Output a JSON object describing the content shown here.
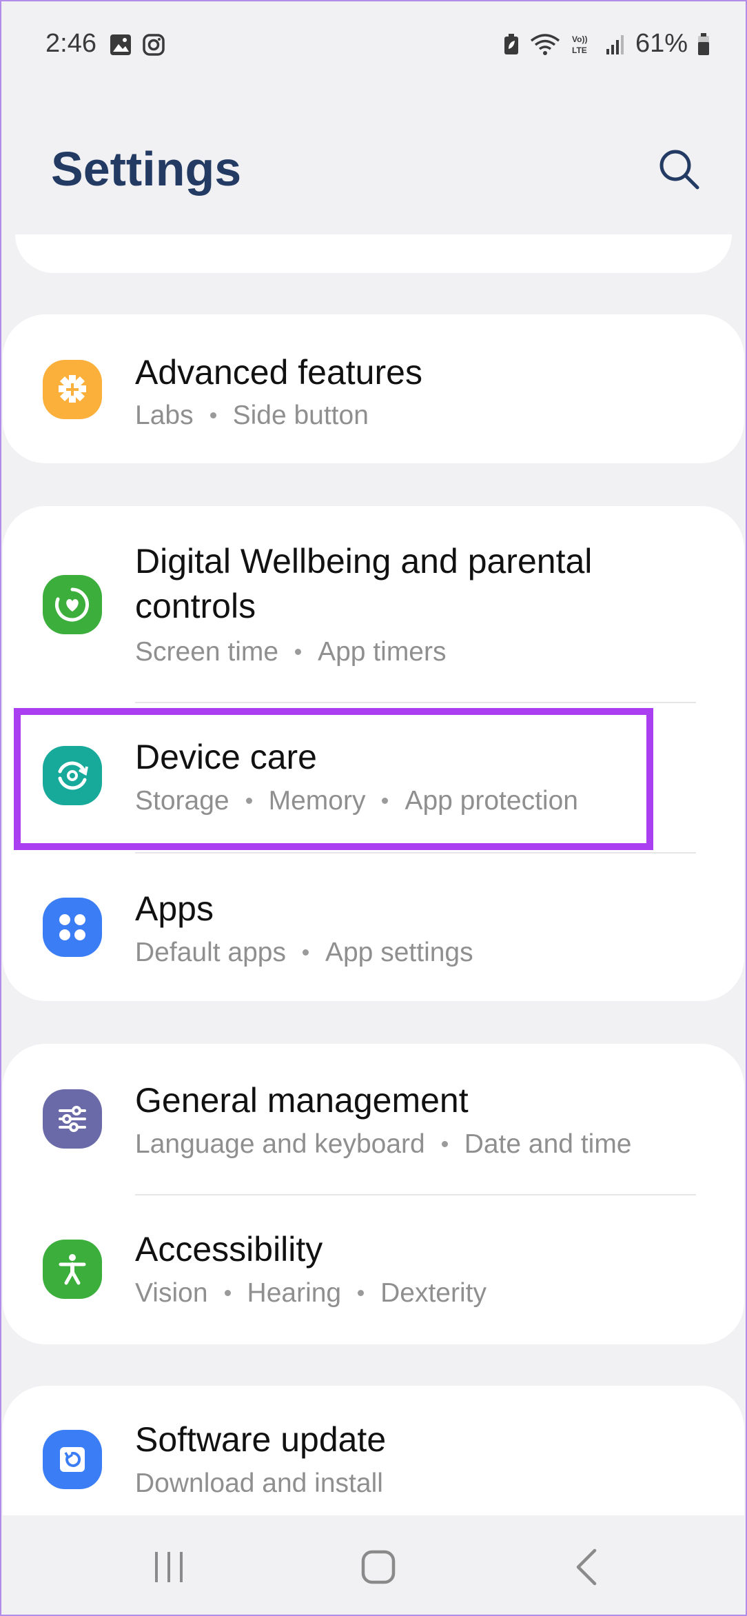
{
  "status_bar": {
    "time": "2:46",
    "battery_percent": "61%"
  },
  "header": {
    "title": "Settings"
  },
  "sections": [
    {
      "items": [
        {
          "title": "Advanced features",
          "subtitle": [
            "Labs",
            "Side button"
          ],
          "icon": "advanced-features-icon",
          "icon_color": "#fbb03b"
        }
      ]
    },
    {
      "items": [
        {
          "title": "Digital Wellbeing and parental controls",
          "subtitle": [
            "Screen time",
            "App timers"
          ],
          "icon": "digital-wellbeing-icon",
          "icon_color": "#3cae3c"
        },
        {
          "title": "Device care",
          "subtitle": [
            "Storage",
            "Memory",
            "App protection"
          ],
          "icon": "device-care-icon",
          "icon_color": "#17a99a"
        },
        {
          "title": "Apps",
          "subtitle": [
            "Default apps",
            "App settings"
          ],
          "icon": "apps-icon",
          "icon_color": "#3b7df5"
        }
      ]
    },
    {
      "items": [
        {
          "title": "General management",
          "subtitle": [
            "Language and keyboard",
            "Date and time"
          ],
          "icon": "general-management-icon",
          "icon_color": "#6b6aa8"
        },
        {
          "title": "Accessibility",
          "subtitle": [
            "Vision",
            "Hearing",
            "Dexterity"
          ],
          "icon": "accessibility-icon",
          "icon_color": "#3cae3c"
        }
      ]
    },
    {
      "items": [
        {
          "title": "Software update",
          "subtitle": [
            "Download and install"
          ],
          "icon": "software-update-icon",
          "icon_color": "#3b7df5"
        }
      ]
    }
  ],
  "highlight_color": "#a93ff0"
}
